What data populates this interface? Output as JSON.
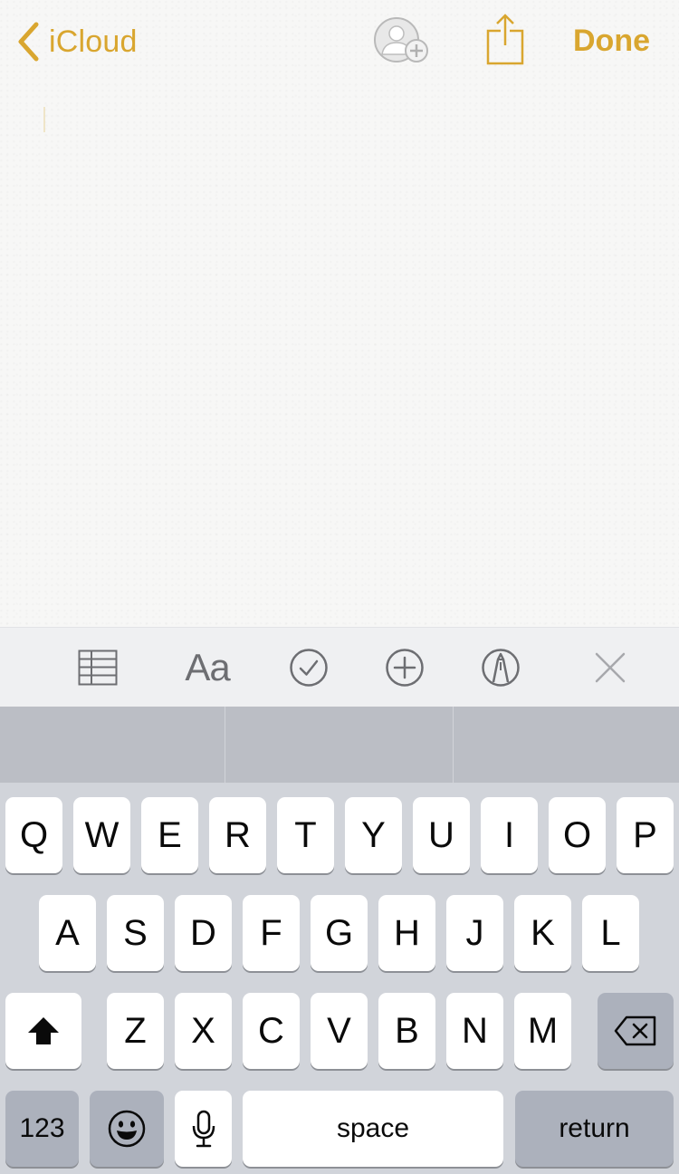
{
  "nav": {
    "back_label": "iCloud",
    "done_label": "Done"
  },
  "toolbar": {
    "format_label": "Aa",
    "items": [
      "table-icon",
      "format-icon",
      "checklist-icon",
      "add-icon",
      "markup-icon",
      "close-icon"
    ]
  },
  "keyboard": {
    "row1": [
      "Q",
      "W",
      "E",
      "R",
      "T",
      "Y",
      "U",
      "I",
      "O",
      "P"
    ],
    "row2": [
      "A",
      "S",
      "D",
      "F",
      "G",
      "H",
      "J",
      "K",
      "L"
    ],
    "row3": [
      "Z",
      "X",
      "C",
      "V",
      "B",
      "N",
      "M"
    ],
    "numbers_label": "123",
    "space_label": "space",
    "return_label": "return"
  },
  "colors": {
    "accent": "#d9a62f",
    "keyboard_bg": "#d1d4da",
    "prediction_bar": "#bbbec5",
    "toolbar_bg": "#eff0f2",
    "dark_key": "#acb1bc"
  }
}
